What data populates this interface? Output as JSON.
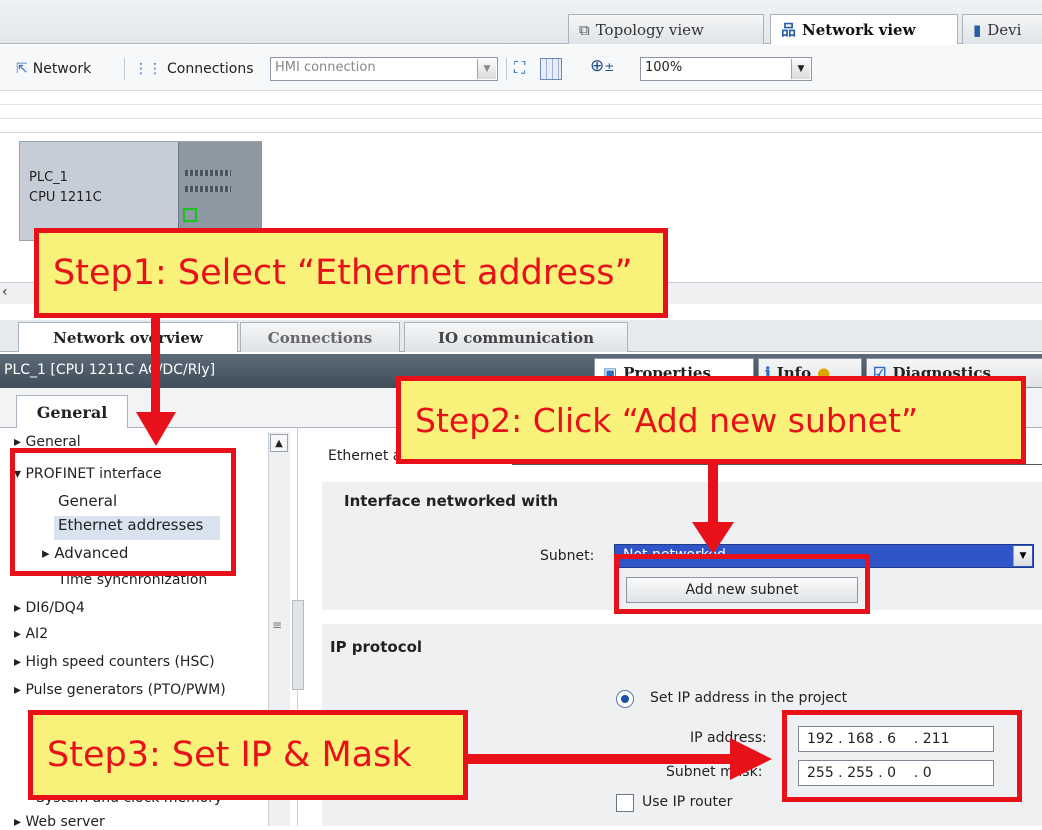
{
  "top_tabs": {
    "topology": "Topology view",
    "network": "Network view",
    "device": "Devi"
  },
  "toolbar": {
    "network_label": "Network",
    "connections_label": "Connections",
    "connection_type": "HMI connection",
    "zoom": "100%"
  },
  "device": {
    "name": "PLC_1",
    "model": "CPU 1211C"
  },
  "bottom_tabs": {
    "overview": "Network overview",
    "connections": "Connections",
    "io": "IO communication"
  },
  "inspector": {
    "title": "PLC_1 [CPU 1211C AC/DC/Rly]",
    "properties": "Properties",
    "info": "Info",
    "diagnostics": "Diagnostics",
    "general_tab": "General"
  },
  "tree": [
    "General",
    "PROFINET interface",
    "General",
    "Ethernet addresses",
    "Advanced",
    "Time synchronization",
    "DI6/DQ4",
    "AI2",
    "High speed counters (HSC)",
    "Pulse generators (PTO/PWM)",
    "System and clock memory",
    "Web server"
  ],
  "content": {
    "section_ethernet": "Ethernet addresses",
    "section_interface": "Interface networked with",
    "subnet_label": "Subnet:",
    "subnet_value": "Not networked",
    "add_subnet": "Add new subnet",
    "section_ip": "IP protocol",
    "set_ip_option": "Set IP address in the project",
    "ip_label": "IP address:",
    "ip_value": "192 . 168 . 6    . 211",
    "mask_label": "Subnet mask:",
    "mask_value": "255 . 255 . 0    . 0",
    "use_router": "Use IP router"
  },
  "callouts": {
    "step1": "Step1: Select “Ethernet address”",
    "step2": "Step2: Click “Add new subnet”",
    "step3": "Step3: Set IP & Mask"
  },
  "colors": {
    "annotation_red": "#e8111a",
    "annotation_fill": "#f8f17a",
    "subnet_blue": "#2f55c9",
    "title_bar": "#4c5a68"
  }
}
